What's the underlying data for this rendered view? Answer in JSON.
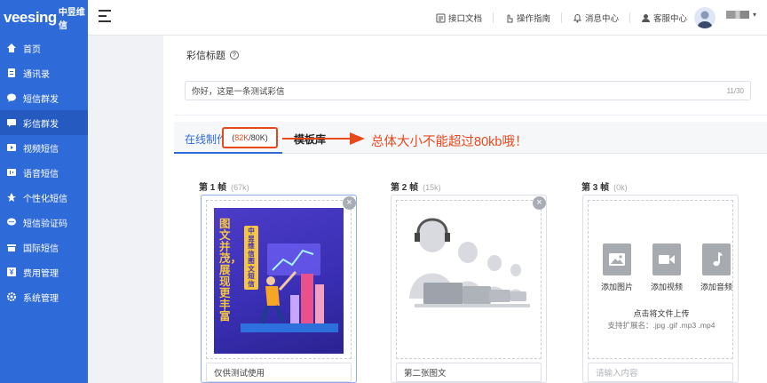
{
  "brand": {
    "name": "veesing",
    "sub": "中昱维信"
  },
  "sidebar": {
    "items": [
      {
        "label": "首页",
        "icon": "home-icon"
      },
      {
        "label": "通讯录",
        "icon": "contacts-icon"
      },
      {
        "label": "短信群发",
        "icon": "chat-icon"
      },
      {
        "label": "彩信群发",
        "icon": "mms-icon",
        "active": true
      },
      {
        "label": "视频短信",
        "icon": "video-icon"
      },
      {
        "label": "语音短信",
        "icon": "voice-icon"
      },
      {
        "label": "个性化短信",
        "icon": "personalize-icon"
      },
      {
        "label": "短信验证码",
        "icon": "verify-icon"
      },
      {
        "label": "国际短信",
        "icon": "international-icon"
      },
      {
        "label": "费用管理",
        "icon": "billing-icon"
      },
      {
        "label": "系统管理",
        "icon": "settings-icon"
      }
    ]
  },
  "header": {
    "links": [
      {
        "label": "接口文档",
        "icon": "doc-icon"
      },
      {
        "label": "操作指南",
        "icon": "hand-pointer-icon"
      },
      {
        "label": "消息中心",
        "icon": "bell-icon"
      },
      {
        "label": "客服中心",
        "icon": "service-icon"
      }
    ],
    "caret": "▾"
  },
  "main": {
    "title_label": "彩信标题",
    "help": "?",
    "title_value": "你好，这是一条测试彩信",
    "title_counter": "11/30",
    "tabs": {
      "online": "在线制作",
      "template": "模板库"
    },
    "size": {
      "current": "82K",
      "sep": "/",
      "limit": "80K",
      "open": "(",
      "close": ")"
    },
    "annotation": "总体大小不能超过80kb哦！",
    "colors": {
      "accent": "#2f6bd8",
      "warn": "#e8491c"
    }
  },
  "frames": [
    {
      "title": "第 1 帧",
      "size": "(67k)",
      "caption": "仅供测试使用",
      "poster": {
        "title": "图文并茂，展现更丰富",
        "tag": "中昱维信图文短信"
      }
    },
    {
      "title": "第 2 帧",
      "size": "(15k)",
      "caption": "第二张图文"
    },
    {
      "title": "第 3 帧",
      "size": "(0k)",
      "caption_placeholder": "请输入内容",
      "media": [
        {
          "label": "添加图片",
          "icon": "image-icon"
        },
        {
          "label": "添加视频",
          "icon": "video-camera-icon"
        },
        {
          "label": "添加音频",
          "icon": "music-icon"
        }
      ],
      "upload_title": "点击将文件上传",
      "upload_ext": "支持扩展名：.jpg .gif .mp3 .mp4"
    }
  ]
}
